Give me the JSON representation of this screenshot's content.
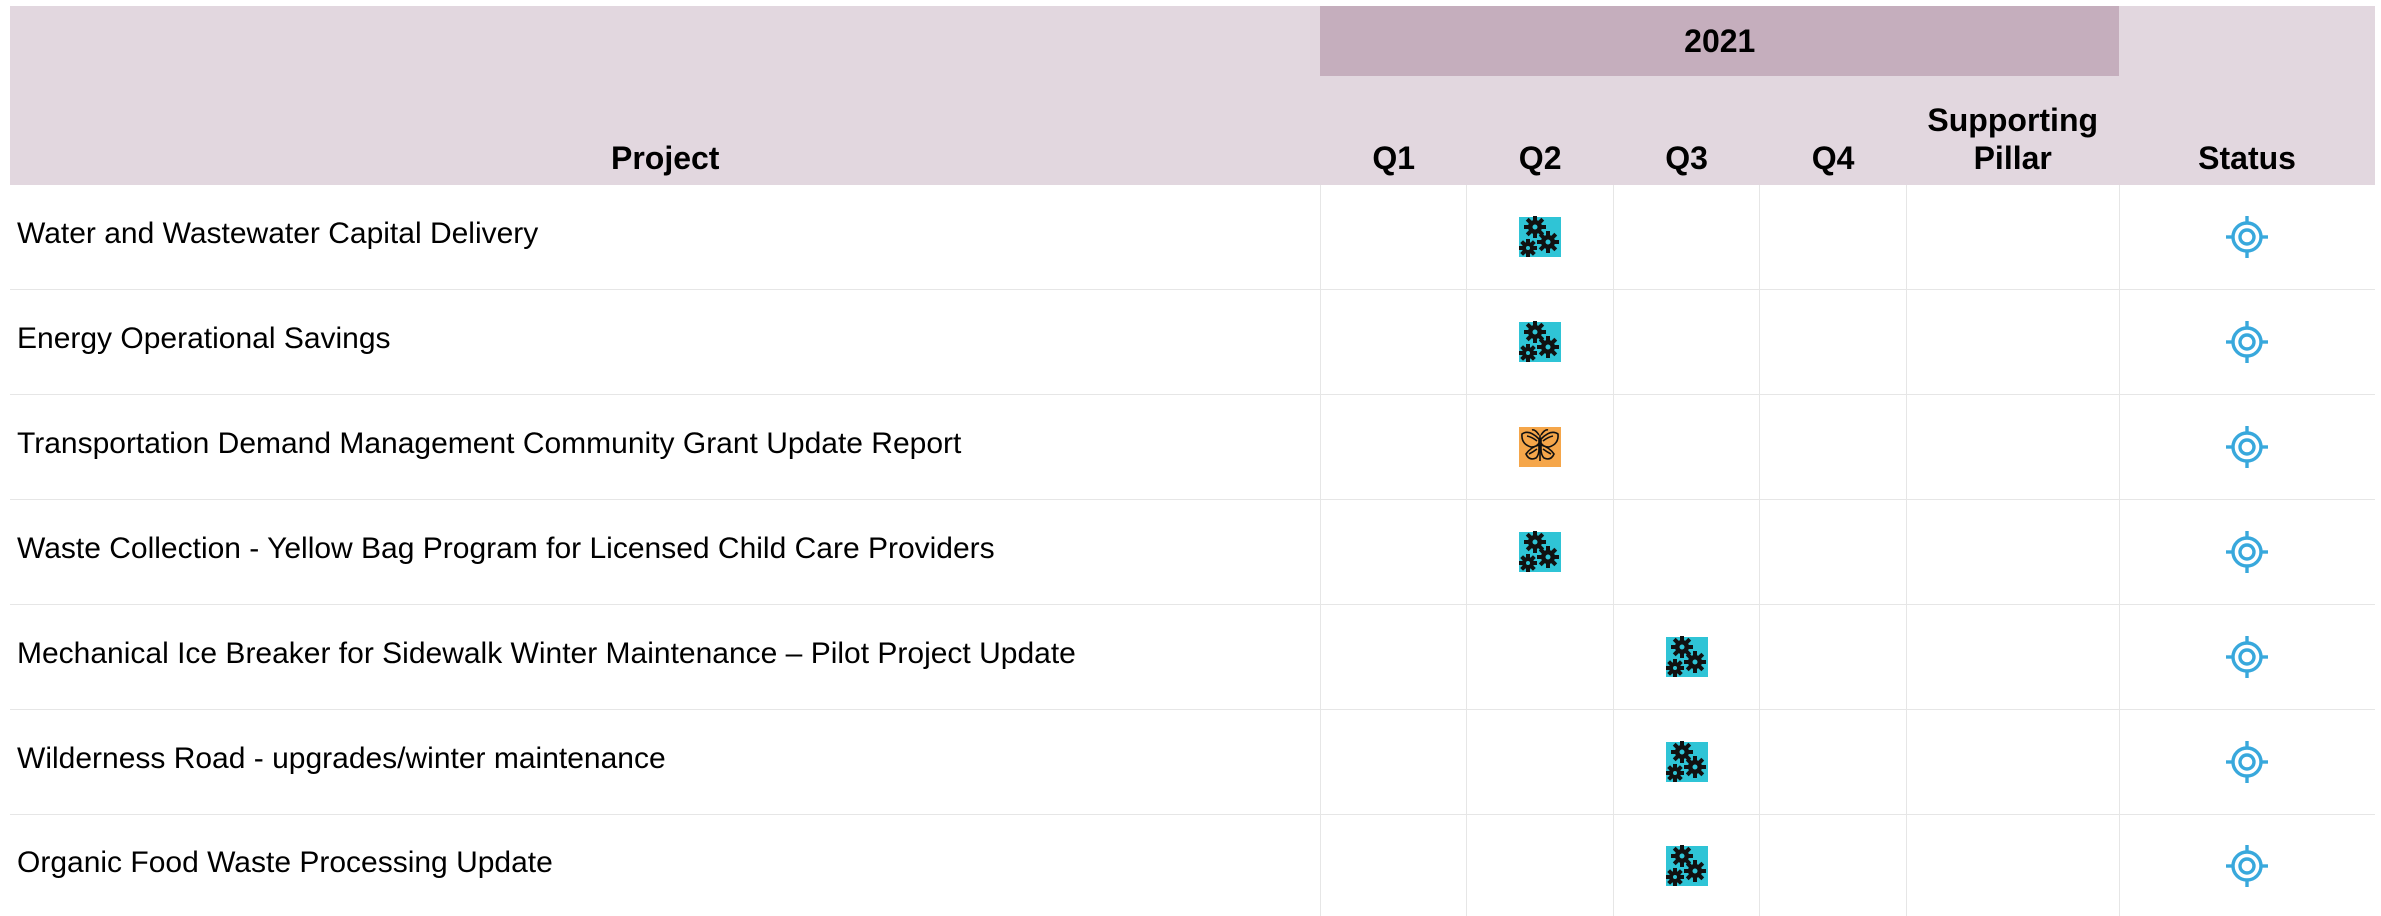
{
  "header": {
    "project_label": "Project",
    "year_label": "2021",
    "q1_label": "Q1",
    "q2_label": "Q2",
    "q3_label": "Q3",
    "q4_label": "Q4",
    "pillar_label_line1": "Supporting",
    "pillar_label_line2": "Pillar",
    "status_label": "Status"
  },
  "colors": {
    "header_bg": "#e2d7df",
    "year_bg": "#c5aebd",
    "gears_tile": "#2fc4d6",
    "butterfly_tile": "#f5a64a",
    "status_icon": "#38a8dc"
  },
  "rows": [
    {
      "project": "Water and Wastewater Capital Delivery",
      "quarter": "Q2",
      "pillar_icon": "gears-icon",
      "status_icon": "target-icon"
    },
    {
      "project": "Energy Operational Savings",
      "quarter": "Q2",
      "pillar_icon": "gears-icon",
      "status_icon": "target-icon"
    },
    {
      "project": "Transportation Demand Management Community Grant Update Report",
      "quarter": "Q2",
      "pillar_icon": "butterfly-icon",
      "status_icon": "target-icon"
    },
    {
      "project": "Waste Collection - Yellow Bag Program for Licensed Child Care Providers",
      "quarter": "Q2",
      "pillar_icon": "gears-icon",
      "status_icon": "target-icon"
    },
    {
      "project": "Mechanical Ice Breaker for Sidewalk Winter Maintenance – Pilot Project Update",
      "quarter": "Q3",
      "pillar_icon": "gears-icon",
      "status_icon": "target-icon"
    },
    {
      "project": "Wilderness Road - upgrades/winter maintenance",
      "quarter": "Q3",
      "pillar_icon": "gears-icon",
      "status_icon": "target-icon"
    },
    {
      "project": "Organic Food Waste Processing Update",
      "quarter": "Q3",
      "pillar_icon": "gears-icon",
      "status_icon": "target-icon"
    }
  ]
}
